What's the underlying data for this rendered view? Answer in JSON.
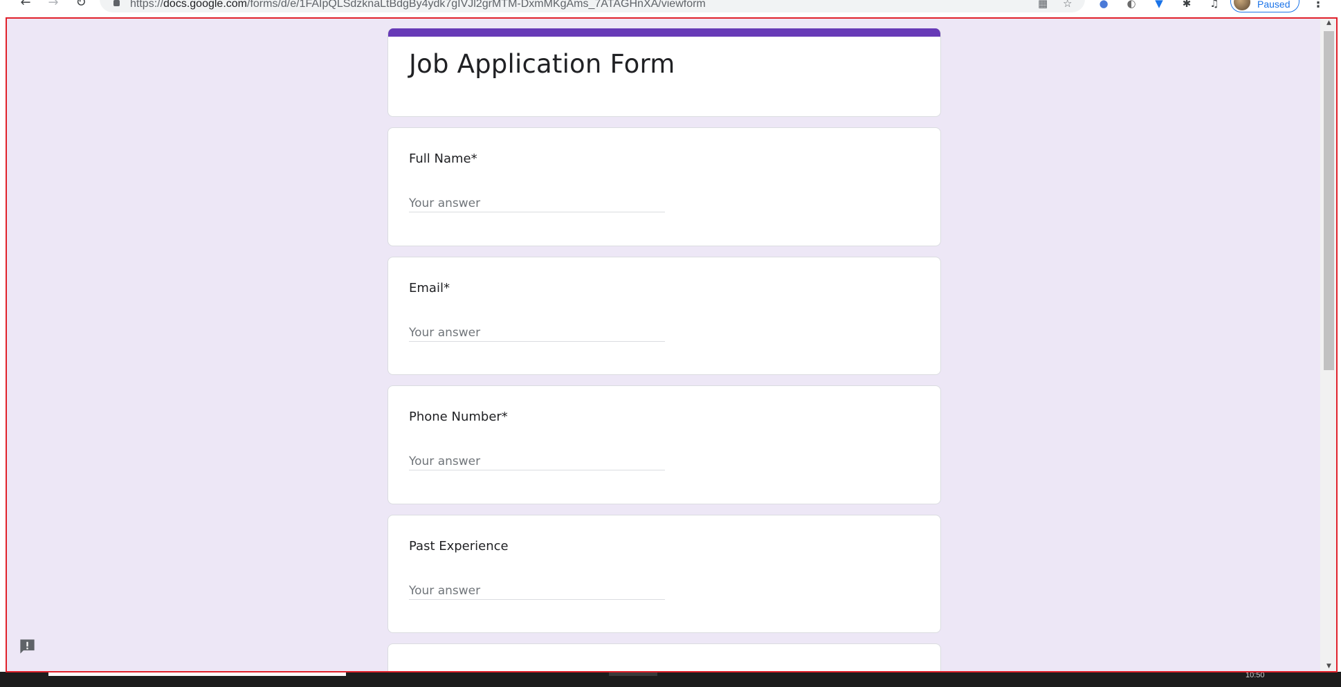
{
  "browser": {
    "url_scheme": "https://",
    "url_host": "docs.google.com",
    "url_path": "/forms/d/e/1FAIpQLSdzknaLtBdgBy4ydk7gIVJl2grMTM-DxmMKgAms_7ATAGHnXA/viewform",
    "profile_label": "Paused",
    "icons": {
      "back": "arrow-left-icon",
      "forward": "arrow-right-icon",
      "reload": "reload-icon",
      "lock": "lock-icon",
      "tab_search": "tab-search-icon",
      "bookmark": "star-icon",
      "extensions": [
        "extension-1-icon",
        "extension-2-icon",
        "vpn-extension-icon",
        "puzzle-icon",
        "media-control-icon"
      ],
      "menu": "three-dots-menu-icon"
    }
  },
  "form": {
    "title": "Job Application Form",
    "accent_color": "#673ab7",
    "background_color": "#ede7f6",
    "questions": [
      {
        "label": "Full Name*",
        "placeholder": "Your answer",
        "value": ""
      },
      {
        "label": "Email*",
        "placeholder": "Your answer",
        "value": ""
      },
      {
        "label": "Phone Number*",
        "placeholder": "Your answer",
        "value": ""
      },
      {
        "label": "Past Experience",
        "placeholder": "Your answer",
        "value": ""
      }
    ]
  },
  "feedback_button": {
    "icon": "feedback-icon"
  },
  "taskbar": {
    "clock": "10:50"
  }
}
